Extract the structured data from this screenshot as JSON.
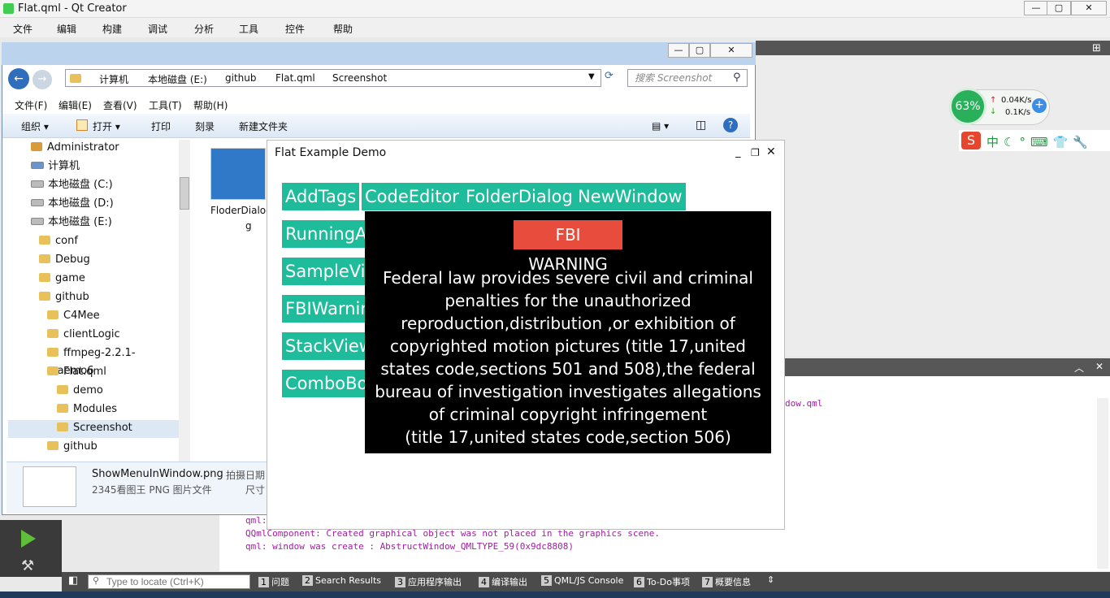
{
  "qt": {
    "title": "Flat.qml - Qt Creator",
    "menu": [
      "文件",
      "编辑",
      "构建",
      "调试",
      "分析",
      "工具",
      "控件",
      "帮助"
    ],
    "log_lines": [
      "qml:",
      "QQmlComponent: Created graphical object was not placed in the graphics scene.",
      "qml: window was create : AbstructWindow_QMLTYPE_59(0x9dc8808)"
    ],
    "log_tail": "dow.qml",
    "locate_placeholder": "Type to locate (Ctrl+K)",
    "status_tabs": [
      {
        "num": "1",
        "label": "问题"
      },
      {
        "num": "2",
        "label": "Search Results"
      },
      {
        "num": "3",
        "label": "应用程序输出"
      },
      {
        "num": "4",
        "label": "编译输出"
      },
      {
        "num": "5",
        "label": "QML/JS Console"
      },
      {
        "num": "6",
        "label": "To-Do事项"
      },
      {
        "num": "7",
        "label": "概要信息"
      }
    ]
  },
  "explorer": {
    "breadcrumbs": [
      "计算机",
      "本地磁盘 (E:)",
      "github",
      "Flat.qml",
      "Screenshot"
    ],
    "search_placeholder": "搜索 Screenshot",
    "menu": [
      "文件(F)",
      "编辑(E)",
      "查看(V)",
      "工具(T)",
      "帮助(H)"
    ],
    "toolbar": [
      "组织 ▾",
      "打开 ▾",
      "打印",
      "刻录",
      "新建文件夹"
    ],
    "tree": [
      {
        "label": "Administrator",
        "indent": 1,
        "kind": "user"
      },
      {
        "label": "计算机",
        "indent": 1,
        "kind": "computer"
      },
      {
        "label": "本地磁盘 (C:)",
        "indent": 2,
        "kind": "drive"
      },
      {
        "label": "本地磁盘 (D:)",
        "indent": 2,
        "kind": "drive"
      },
      {
        "label": "本地磁盘 (E:)",
        "indent": 2,
        "kind": "drive"
      },
      {
        "label": "conf",
        "indent": 3,
        "kind": "folder"
      },
      {
        "label": "Debug",
        "indent": 3,
        "kind": "folder"
      },
      {
        "label": "game",
        "indent": 3,
        "kind": "folder"
      },
      {
        "label": "github",
        "indent": 3,
        "kind": "folder"
      },
      {
        "label": "C4Mee",
        "indent": 4,
        "kind": "folder"
      },
      {
        "label": "clientLogic",
        "indent": 4,
        "kind": "folder"
      },
      {
        "label": "ffmpeg-2.2.1-maemo6",
        "indent": 4,
        "kind": "folder"
      },
      {
        "label": "Flat.qml",
        "indent": 4,
        "kind": "folder"
      },
      {
        "label": "demo",
        "indent": 5,
        "kind": "folder"
      },
      {
        "label": "Modules",
        "indent": 5,
        "kind": "folder"
      },
      {
        "label": "Screenshot",
        "indent": 5,
        "kind": "folder"
      },
      {
        "label": "github",
        "indent": 4,
        "kind": "folder"
      }
    ],
    "file_thumb_label": "FloderDialog",
    "file_thumb_label2": "g",
    "details": {
      "name": "ShowMenuInWindow.png",
      "type": "2345看图王 PNG 图片文件",
      "date_label": "拍摄日期",
      "size_label": "尺寸"
    }
  },
  "demo": {
    "title": "Flat Example Demo",
    "buttons": [
      "AddTags",
      "CodeEditor",
      "FolderDialog",
      "NewWindow",
      "RunningAp",
      "SampleVid",
      "FBIWarnin",
      "StackView",
      "ComboBox"
    ],
    "fbi_title": "FBI WARNING",
    "fbi_text_1": "Federal law provides severe civil and criminal penalties for the unauthorized reproduction,distribution ,or exhibition of copyrighted motion pictures (title 17,united states code,sections 501 and 508),the federal bureau of investigation investigates allegations of criminal copyright infringement",
    "fbi_text_2": "(title 17,united states code,section 506)"
  },
  "widget": {
    "percent": "63%",
    "up": "0.04K/s",
    "down": "0.1K/s"
  }
}
